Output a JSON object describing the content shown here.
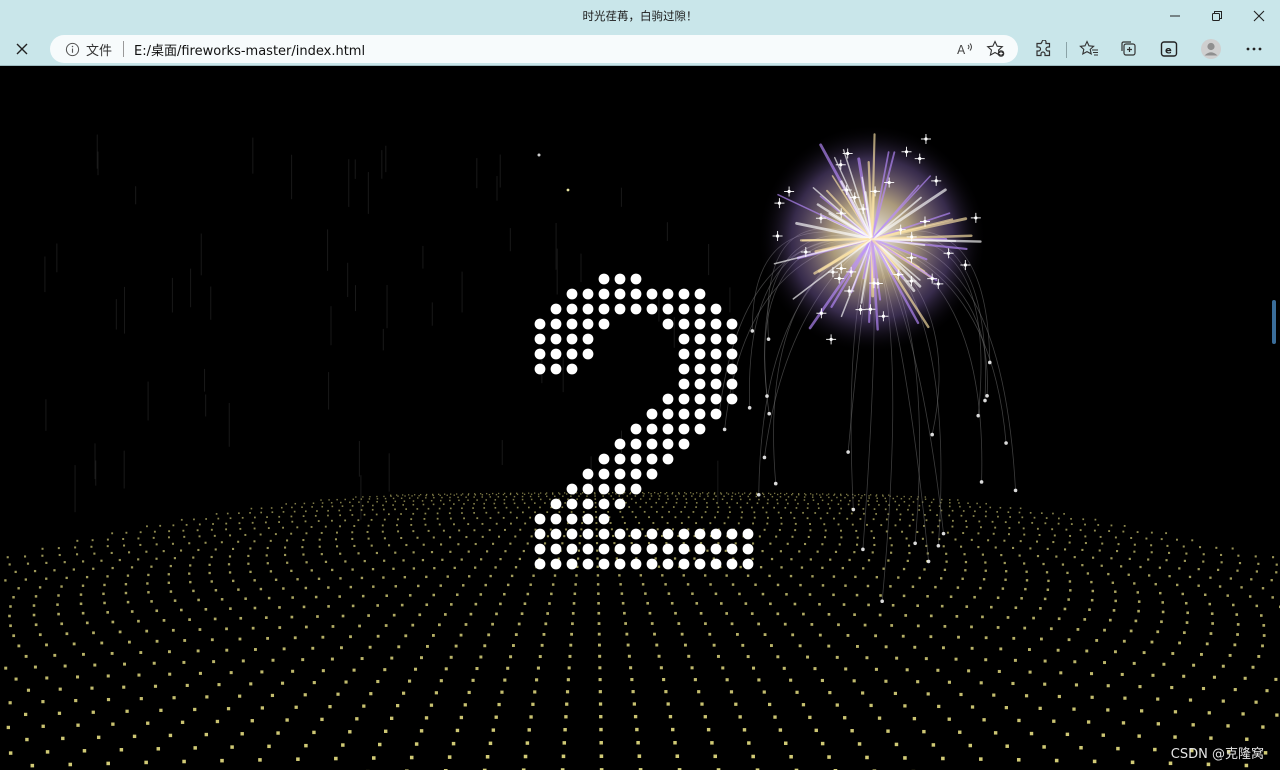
{
  "window": {
    "title": "时光荏苒，白驹过隙！",
    "controls": {
      "minimize_icon": "minimize-icon",
      "restore_icon": "restore-icon",
      "close_icon": "close-icon"
    }
  },
  "address_bar": {
    "close_tab_icon": "close-icon",
    "security_icon": "info-icon",
    "security_label": "文件",
    "url": "E:/桌面/fireworks-master/index.html",
    "read_aloud_icon": "read-aloud-icon",
    "add_favorite_icon": "add-favorite-icon"
  },
  "toolbar_icons": [
    "extensions-icon",
    "favorites-icon",
    "collections-icon",
    "edge-icon",
    "profile-avatar",
    "more-icon"
  ],
  "page": {
    "background": "#000000",
    "numeral_color": "#ffffff",
    "grid_color": "#d9d27a",
    "firework_colors": [
      "#ffe6a8",
      "#b98cff",
      "#ffffff"
    ],
    "watermark": "CSDN @克隆窝"
  }
}
